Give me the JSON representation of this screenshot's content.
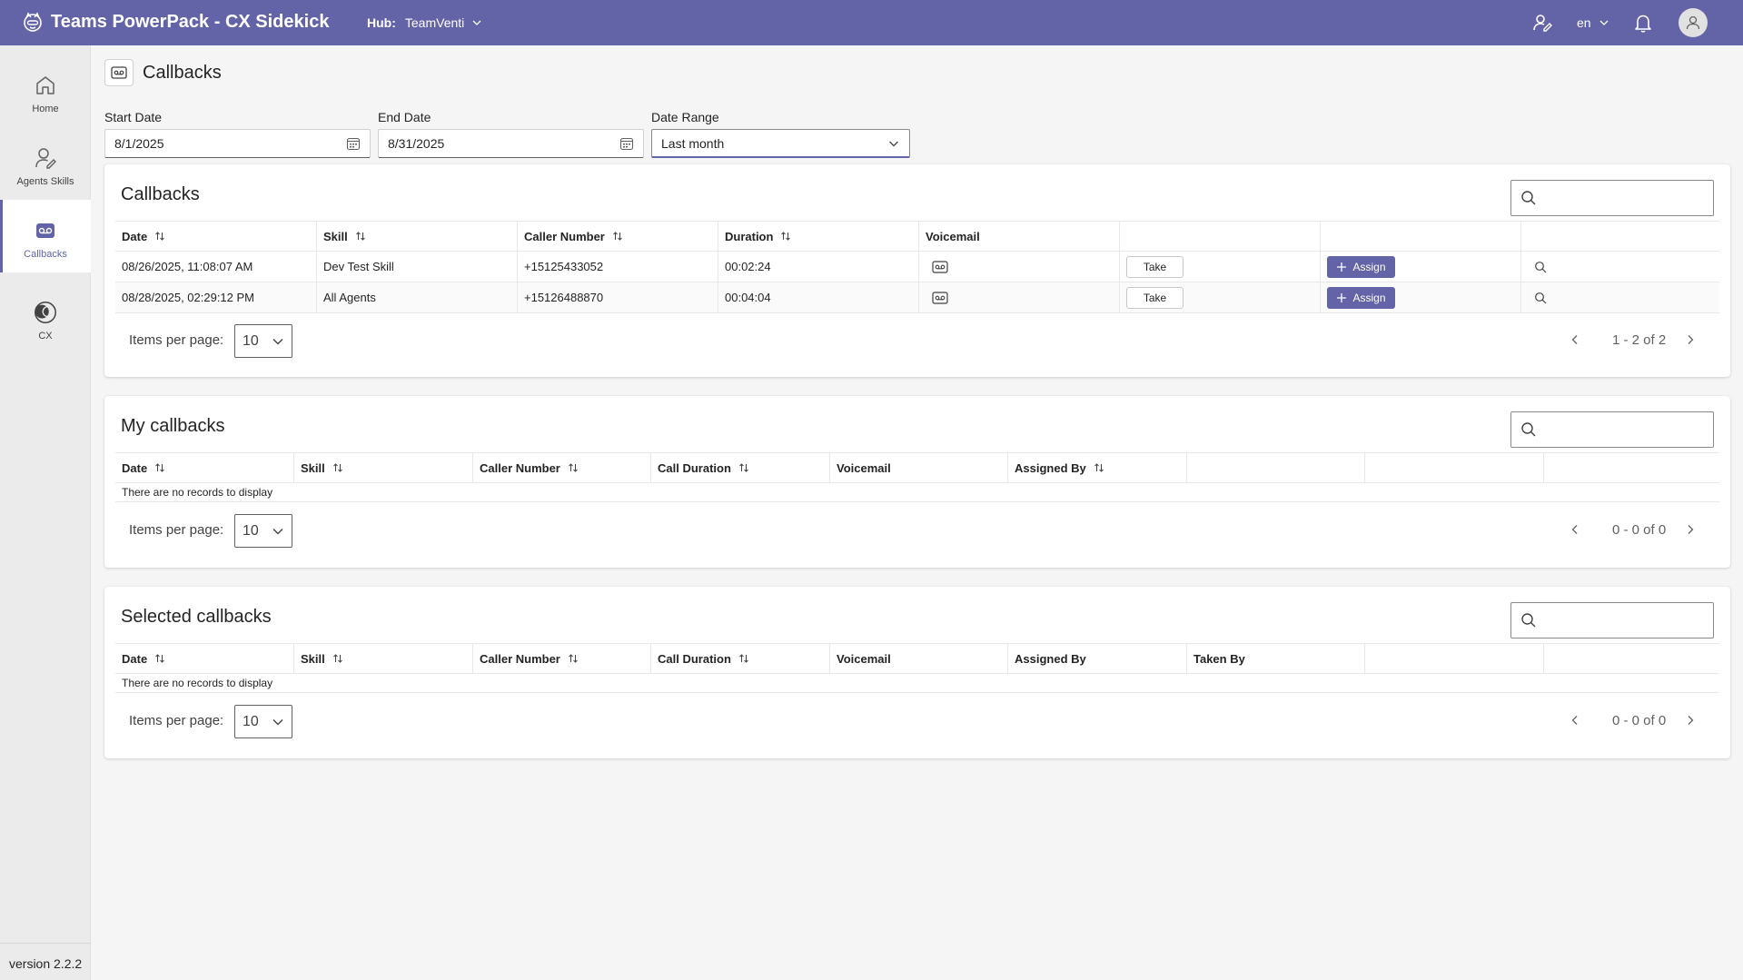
{
  "app": {
    "title": "Teams PowerPack - CX Sidekick"
  },
  "hub": {
    "label": "Hub:",
    "value": "TeamVenti"
  },
  "header": {
    "language": "en"
  },
  "sidebar": {
    "items": [
      {
        "label": "Home",
        "icon": "home-icon"
      },
      {
        "label": "Agents Skills",
        "icon": "agent-skills-icon"
      },
      {
        "label": "Callbacks",
        "icon": "voicemail-icon"
      },
      {
        "label": "CX",
        "icon": "cx-icon"
      }
    ],
    "version": "version 2.2.2"
  },
  "page": {
    "title": "Callbacks"
  },
  "filters": {
    "start_date": {
      "label": "Start Date",
      "value": "8/1/2025"
    },
    "end_date": {
      "label": "End Date",
      "value": "8/31/2025"
    },
    "date_range": {
      "label": "Date Range",
      "value": "Last month"
    }
  },
  "callbacks": {
    "title": "Callbacks",
    "columns": [
      "Date",
      "Skill",
      "Caller Number",
      "Duration",
      "Voicemail"
    ],
    "rows": [
      {
        "date": "08/26/2025, 11:08:07 AM",
        "skill": "Dev Test Skill",
        "caller": "+15125433052",
        "duration": "00:02:24",
        "take": "Take",
        "assign": "Assign"
      },
      {
        "date": "08/28/2025, 02:29:12 PM",
        "skill": "All Agents",
        "caller": "+15126488870",
        "duration": "00:04:04",
        "take": "Take",
        "assign": "Assign"
      }
    ],
    "items_per_page_label": "Items per page:",
    "items_per_page": "10",
    "range": "1 - 2 of 2"
  },
  "my_callbacks": {
    "title": "My callbacks",
    "columns": [
      "Date",
      "Skill",
      "Caller Number",
      "Call Duration",
      "Voicemail",
      "Assigned By"
    ],
    "empty": "There are no records to display",
    "items_per_page_label": "Items per page:",
    "items_per_page": "10",
    "range": "0 - 0 of 0"
  },
  "selected_callbacks": {
    "title": "Selected callbacks",
    "columns": [
      "Date",
      "Skill",
      "Caller Number",
      "Call Duration",
      "Voicemail",
      "Assigned By",
      "Taken By"
    ],
    "empty": "There are no records to display",
    "items_per_page_label": "Items per page:",
    "items_per_page": "10",
    "range": "0 - 0 of 0"
  },
  "colors": {
    "brand": "#6264a7",
    "sidebar_bg": "#ebebeb",
    "page_bg": "#f5f5f5"
  }
}
